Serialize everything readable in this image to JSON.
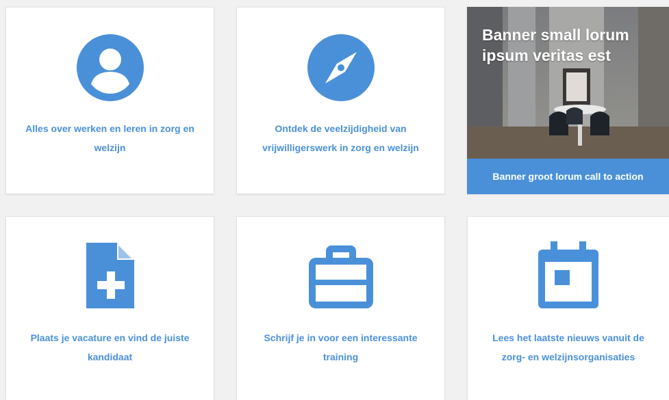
{
  "colors": {
    "accent": "#4a90d9",
    "card_background": "#ffffff",
    "page_background": "#f1f1f1"
  },
  "cards": [
    {
      "icon": "person-icon",
      "label": "Alles over werken en leren in zorg en welzijn"
    },
    {
      "icon": "compass-icon",
      "label": "Ontdek de veelzijdigheid van vrijwilligerswerk in zorg en welzijn"
    },
    {
      "icon": "document-add-icon",
      "label": "Plaats je vacature en vind de juiste kandidaat"
    },
    {
      "icon": "briefcase-icon",
      "label": "Schrijf je in voor een interessante training"
    },
    {
      "icon": "calendar-icon",
      "label": "Lees het laatste nieuws vanuit de zorg- en welzijnsorganisaties"
    }
  ],
  "banner": {
    "title": "Banner small lorum ipsum veritas est",
    "cta_label": "Banner groot lorum call to action"
  }
}
